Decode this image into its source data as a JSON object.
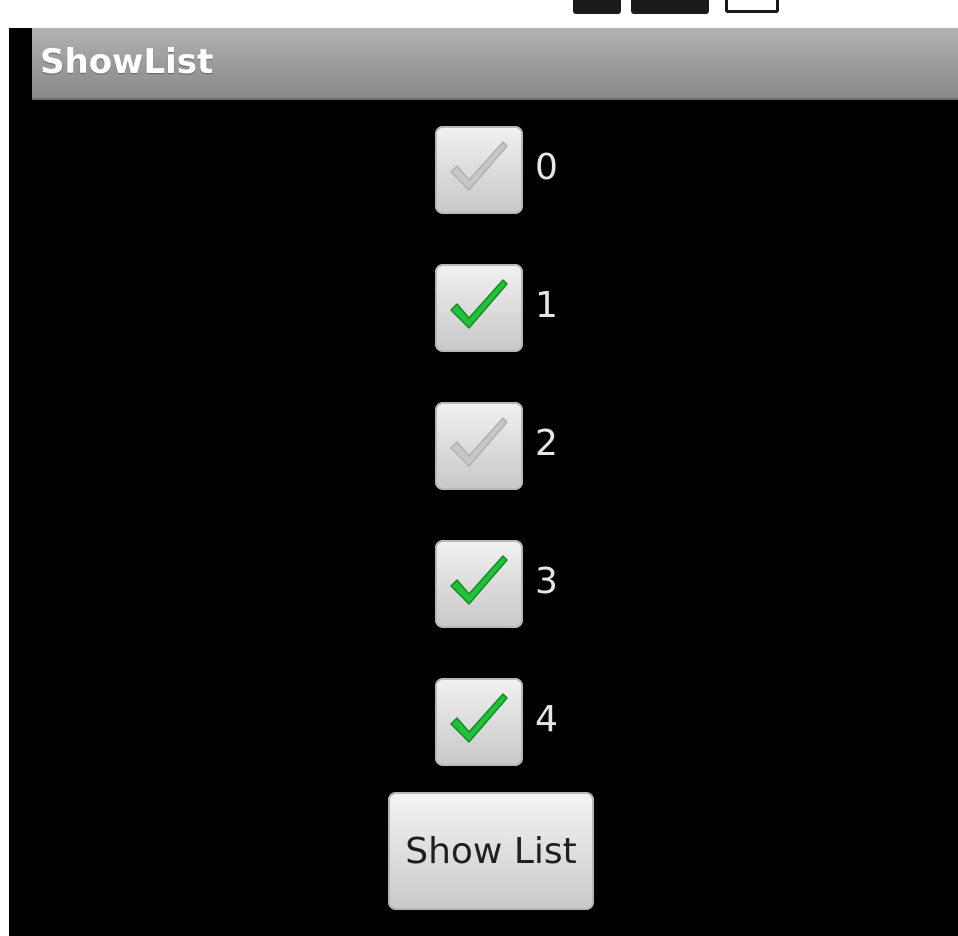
{
  "app": {
    "title": "ShowList"
  },
  "checkboxes": [
    {
      "label": "0",
      "checked": false
    },
    {
      "label": "1",
      "checked": true
    },
    {
      "label": "2",
      "checked": false
    },
    {
      "label": "3",
      "checked": true
    },
    {
      "label": "4",
      "checked": true
    }
  ],
  "button": {
    "label": "Show List"
  },
  "colors": {
    "check_on": "#22c13a",
    "check_off": "#c7c7c7",
    "title_bar": "#9a9a9a",
    "background": "#000000"
  },
  "icons": {
    "checked": "check-icon",
    "unchecked": "check-icon-dim"
  }
}
